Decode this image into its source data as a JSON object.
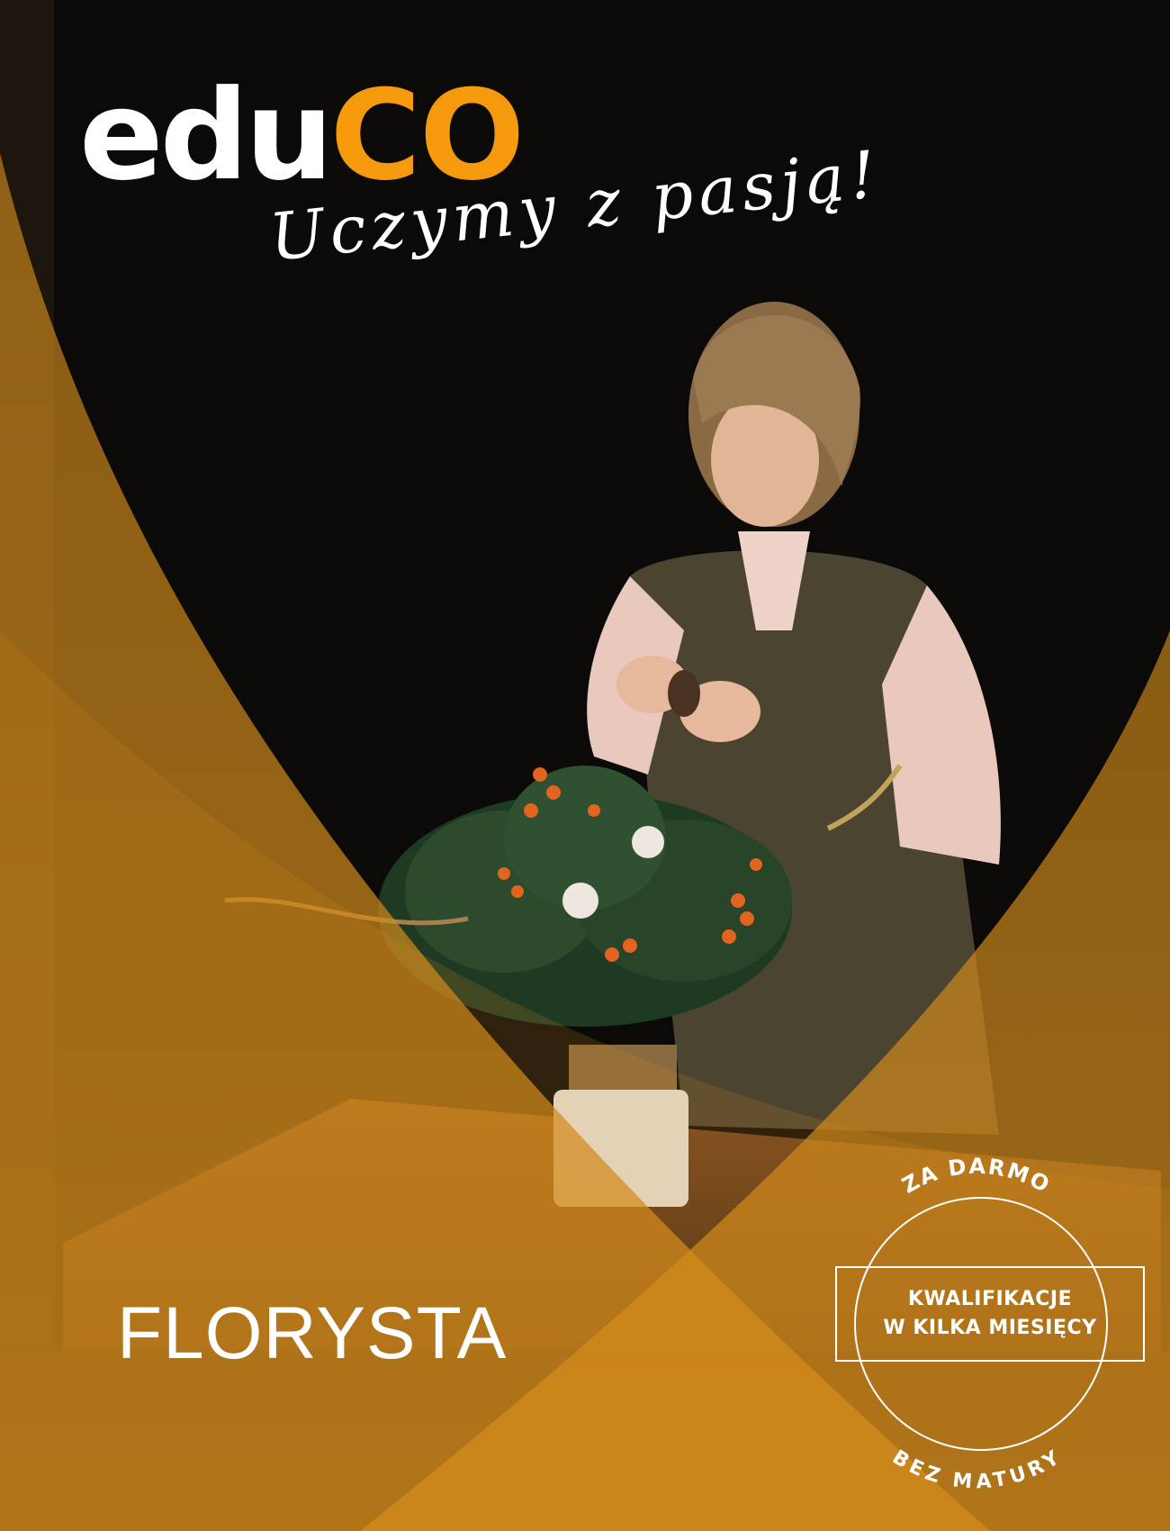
{
  "brand": {
    "logo_part1": "edu",
    "logo_part2": "CO",
    "tagline": "Uczymy z pasją!",
    "accent_color": "#f59a0c"
  },
  "title": "FLORYSTA",
  "badge": {
    "top_text": "ZA DARMO",
    "bottom_text": "BEZ MATURY",
    "line1": "KWALIFIKACJE",
    "line2": "W KILKA MIESIĘCY"
  },
  "photo": {
    "subject": "florist-woman-icon",
    "bouquet": "bouquet-icon"
  }
}
